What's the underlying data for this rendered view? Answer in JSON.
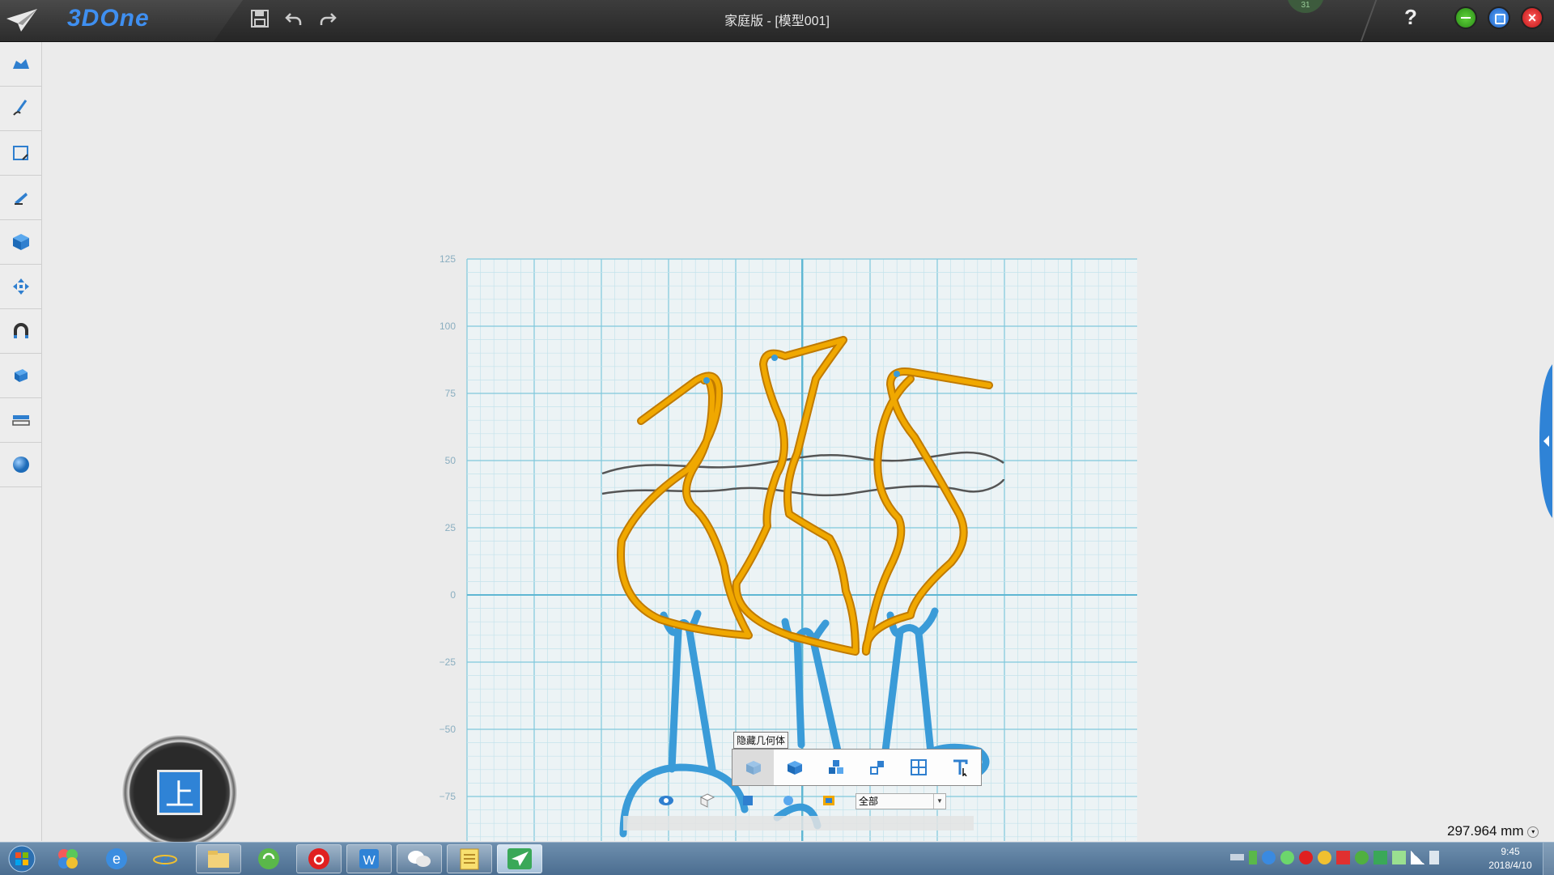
{
  "app": {
    "logo_text": "3DOne",
    "title": "家庭版 - [模型001]",
    "help": "?"
  },
  "toolbar": {
    "save": "save-icon",
    "undo": "undo-icon",
    "redo": "redo-icon"
  },
  "badge": "31",
  "sidebar": {
    "items": [
      "cloud-shape-icon",
      "sketch-pen-icon",
      "sketch-edit-icon",
      "feature-icon",
      "solid-box-icon",
      "move-icon",
      "magnet-icon",
      "combine-icon",
      "measure-icon",
      "sphere-icon"
    ]
  },
  "axis": {
    "y_ticks": [
      "125",
      "100",
      "75",
      "50",
      "25",
      "0",
      "−25",
      "−50",
      "−75"
    ]
  },
  "view_cube": {
    "label": "上"
  },
  "tooltip": "隐藏几何体",
  "filter": {
    "value": "全部"
  },
  "status": {
    "distance": "297.964 mm"
  },
  "clock": {
    "time": "9:45",
    "date": "2018/4/10"
  },
  "colors": {
    "grid": "#7fc8dc",
    "crane": "#f0a800",
    "legs": "#3a9bd8",
    "accent": "#3f8ff0"
  }
}
